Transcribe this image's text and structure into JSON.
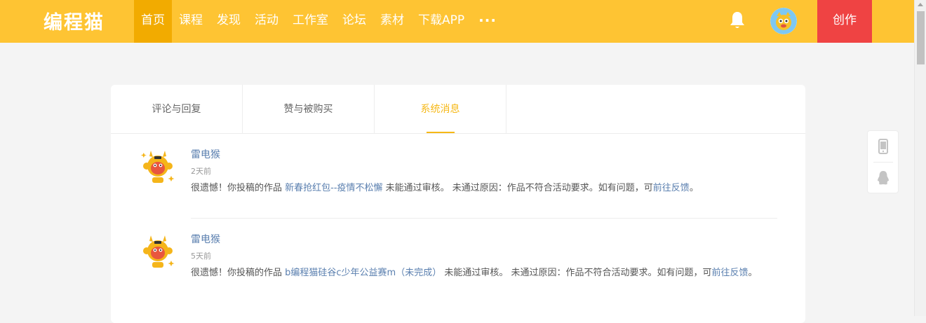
{
  "header": {
    "logo": "编程猫",
    "nav": [
      "首页",
      "课程",
      "发现",
      "活动",
      "工作室",
      "论坛",
      "素材",
      "下载APP"
    ],
    "more": "···",
    "create": "创作"
  },
  "tabs": [
    "评论与回复",
    "赞与被购买",
    "系统消息"
  ],
  "messages": [
    {
      "sender": "雷电猴",
      "time": "2天前",
      "pre": "很遗憾！你投稿的作品 ",
      "work": "新春抢红包--疫情不松懈",
      "mid": " 未能通过审核。 未通过原因：作品不符合活动要求。如有问题，可",
      "link": "前往反馈",
      "post": "。"
    },
    {
      "sender": "雷电猴",
      "time": "5天前",
      "pre": "很遗憾！你投稿的作品 ",
      "work": "b编程猫硅谷c少年公益赛m（未完成）",
      "mid": " 未能通过审核。 未通过原因：作品不符合活动要求。如有问题，可",
      "link": "前往反馈",
      "post": "。"
    }
  ],
  "colors": {
    "header": "#fec433",
    "active_nav": "#f2ab00",
    "create": "#ef4343",
    "accent": "#f6b817",
    "link": "#5a7faf"
  }
}
